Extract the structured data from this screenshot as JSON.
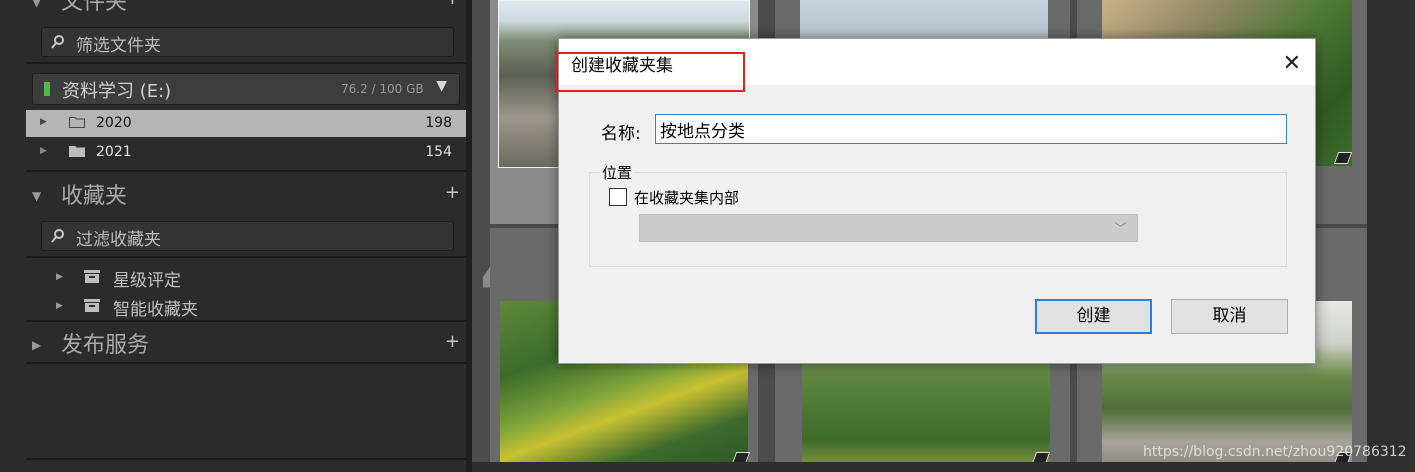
{
  "left_panel": {
    "folders_header": {
      "title": "文件夹"
    },
    "folder_search": {
      "placeholder": "筛选文件夹"
    },
    "volume": {
      "name": "资料学习 (E:)",
      "usage": "76.2 / 100 GB"
    },
    "folders": [
      {
        "name": "2020",
        "count": "198",
        "selected": true
      },
      {
        "name": "2021",
        "count": "154",
        "selected": false
      }
    ],
    "collections_header": {
      "title": "收藏夹"
    },
    "collection_search": {
      "placeholder": "过滤收藏夹"
    },
    "collection_sets": [
      {
        "name": "星级评定"
      },
      {
        "name": "智能收藏夹"
      }
    ],
    "publish_header": {
      "title": "发布服务"
    }
  },
  "grid": {
    "visible_index": "4"
  },
  "dialog": {
    "title": "创建收藏夹集",
    "name_label": "名称:",
    "name_value": "按地点分类",
    "location_label": "位置",
    "inside_checkbox_label": "在收藏夹集内部",
    "inside_checked": false,
    "create_label": "创建",
    "cancel_label": "取消"
  },
  "watermark": "https://blog.csdn.net/zhou920786312",
  "colors": {
    "highlight_box": "#e02020",
    "focus_blue": "#2b7fd6",
    "volume_led": "#4fb84f"
  }
}
